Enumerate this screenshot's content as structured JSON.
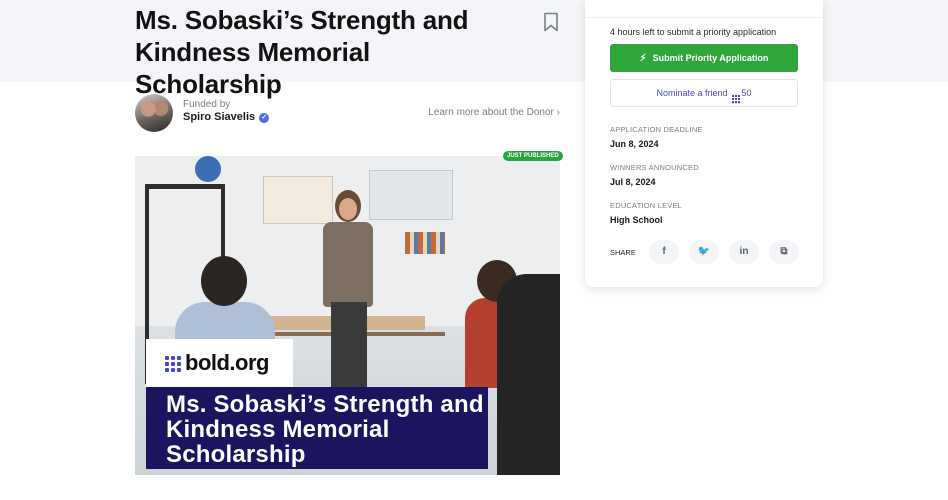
{
  "scholarship": {
    "title": "Ms. Sobaski’s Strength and Kindness Memorial Scholarship",
    "bookmark_icon": "bookmark-icon"
  },
  "donor": {
    "funded_label": "Funded by",
    "name": "Spiro Siavelis",
    "verified_icon": "verified-check-icon",
    "learn_more": "Learn more about the Donor"
  },
  "hero": {
    "badge": "JUST PUBLISHED",
    "logo_text": "bold.org",
    "caption": "Ms. Sobaski’s Strength and Kindness Memorial Scholarship"
  },
  "sidebar": {
    "time_left": "4 hours left to submit a priority application",
    "submit_label": "Submit Priority Application",
    "nominate_label": "Nominate a friend",
    "nominate_count": "50",
    "fields": [
      {
        "label": "APPLICATION DEADLINE",
        "value": "Jun 8, 2024"
      },
      {
        "label": "WINNERS ANNOUNCED",
        "value": "Jul 8, 2024"
      },
      {
        "label": "EDUCATION LEVEL",
        "value": "High School"
      }
    ],
    "share_label": "SHARE",
    "share_buttons": [
      {
        "icon": "facebook-icon",
        "glyph": "f"
      },
      {
        "icon": "twitter-icon",
        "glyph": "🐦"
      },
      {
        "icon": "linkedin-icon",
        "glyph": "in"
      },
      {
        "icon": "copy-link-icon",
        "glyph": "⧉"
      }
    ]
  },
  "colors": {
    "accent_purple": "#4b45d6",
    "submit_green": "#2fa63a",
    "caption_navy": "#1b1560"
  }
}
